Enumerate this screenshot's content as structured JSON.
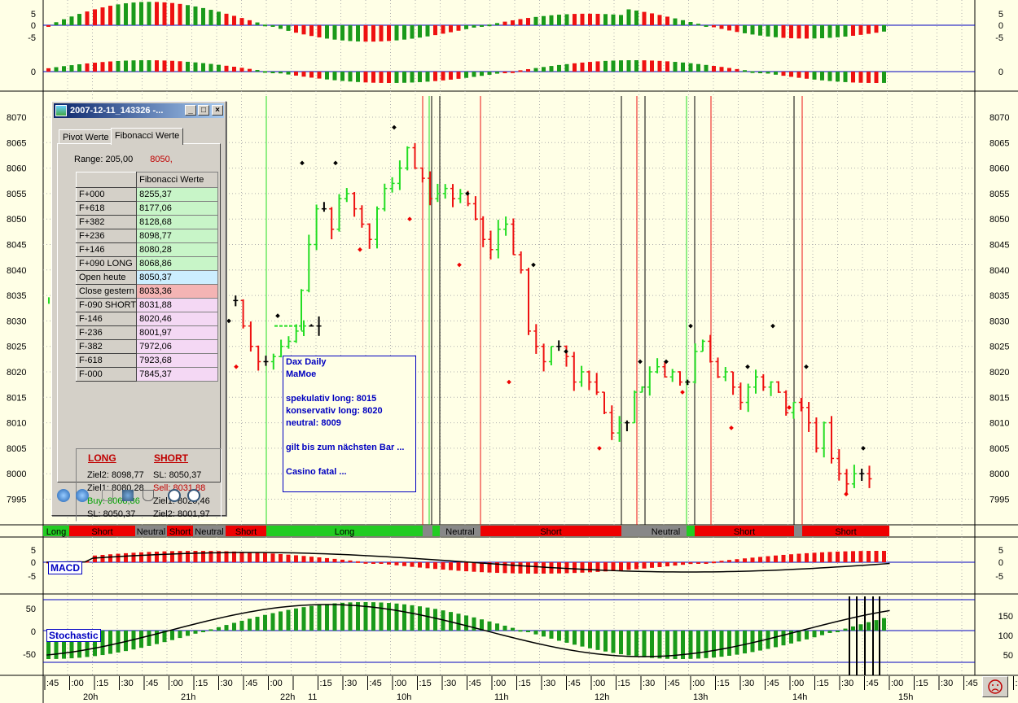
{
  "window": {
    "title": "2007-12-11_143326 -...",
    "tabs": [
      "Pivot Werte",
      "Fibonacci Werte"
    ],
    "range_label": "Range:",
    "range_value": "205,00",
    "range_ref": "8050,",
    "table_header": "Fibonacci Werte",
    "rows": [
      {
        "label": "F+000",
        "value": "8255,37",
        "color": "#c8f5c8"
      },
      {
        "label": "F+618",
        "value": "8177,06",
        "color": "#c8f5c8"
      },
      {
        "label": "F+382",
        "value": "8128,68",
        "color": "#c8f5c8"
      },
      {
        "label": "F+236",
        "value": "8098,77",
        "color": "#c8f5c8"
      },
      {
        "label": "F+146",
        "value": "8080,28",
        "color": "#c8f5c8"
      },
      {
        "label": "F+090 LONG",
        "value": "8068,86",
        "color": "#c8f5c8"
      },
      {
        "label": "Open heute",
        "value": "8050,37",
        "color": "#cceeff"
      },
      {
        "label": "Close gestern",
        "value": "8033,36",
        "color": "#f4b4b4"
      },
      {
        "label": "F-090 SHORT",
        "value": "8031,88",
        "color": "#f4d8f4"
      },
      {
        "label": "F-146",
        "value": "8020,46",
        "color": "#f4d8f4"
      },
      {
        "label": "F-236",
        "value": "8001,97",
        "color": "#f4d8f4"
      },
      {
        "label": "F-382",
        "value": "7972,06",
        "color": "#f4d8f4"
      },
      {
        "label": "F-618",
        "value": "7923,68",
        "color": "#f4d8f4"
      },
      {
        "label": "F-000",
        "value": "7845,37",
        "color": "#f4d8f4"
      }
    ],
    "long": {
      "title": "LONG",
      "ziel2": "Ziel2: 8098,77",
      "ziel1": "Ziel1: 8080,28",
      "buy": "Buy:   8068,86",
      "sl": "SL:    8050,37"
    },
    "short": {
      "title": "SHORT",
      "sl": "SL:    8050,37",
      "sell": "Sell:  8031,88",
      "ziel1": "Ziel1: 8020,46",
      "ziel2": "Ziel2: 8001,97"
    }
  },
  "note": {
    "lines": [
      "Dax Daily",
      "MaMoe",
      "",
      "spekulativ long: 8015",
      "konservativ long: 8020",
      "neutral: 8009",
      "",
      "gilt bis zum nächsten Bar ...",
      "",
      "Casino fatal ..."
    ]
  },
  "indicator_labels": {
    "macd": "MACD",
    "stochastic": "Stochastic"
  },
  "axes": {
    "price_ticks": [
      "8070",
      "8065",
      "8060",
      "8055",
      "8050",
      "8045",
      "8040",
      "8035",
      "8030",
      "8025",
      "8020",
      "8015",
      "8010",
      "8005",
      "8000",
      "7995"
    ],
    "top_ticks_left": [
      "5",
      "0",
      "-5",
      "0"
    ],
    "macd_ticks": [
      "5",
      "0",
      "-5"
    ],
    "stoch_left": [
      "50",
      "0",
      "-50"
    ],
    "stoch_right": [
      "150",
      "100",
      "50"
    ],
    "time_minor": [
      ":45",
      ":00",
      ":15",
      ":30",
      ":45",
      ":00",
      ":15",
      ":30",
      ":45",
      ":00",
      "",
      ":15",
      ":30",
      ":45",
      ":00",
      ":15",
      ":30",
      ":45",
      ":00",
      ":15",
      ":30",
      ":45",
      ":00",
      ":15",
      ":30",
      ":45",
      ":00",
      ":15",
      ":30",
      ":45",
      ":00",
      ":15",
      ":30",
      ":45",
      ":00",
      ":15",
      ":30",
      ":45",
      ":00",
      ":15",
      ":30"
    ],
    "time_hours": [
      "20h",
      "21h",
      "22h",
      "11",
      "10h",
      "11h",
      "12h",
      "13h",
      "14h",
      "15h"
    ]
  },
  "signals": [
    {
      "label": "Long",
      "color": "#22cc22"
    },
    {
      "label": "Short",
      "color": "#ee0000"
    },
    {
      "label": "Neutral",
      "color": "#888888"
    },
    {
      "label": "Short",
      "color": "#ee0000"
    },
    {
      "label": "Neutral",
      "color": "#888888"
    },
    {
      "label": "Short",
      "color": "#ee0000"
    },
    {
      "label": "Long",
      "color": "#22cc22"
    },
    {
      "label": "",
      "color": "#888888"
    },
    {
      "label": "",
      "color": "#22cc22"
    },
    {
      "label": "Neutral",
      "color": "#888888"
    },
    {
      "label": "Short",
      "color": "#ee0000"
    },
    {
      "label": "",
      "color": "#888888"
    },
    {
      "label": "Neutral",
      "color": "#888888"
    },
    {
      "label": "",
      "color": "#22cc22"
    },
    {
      "label": "Short",
      "color": "#ee0000"
    },
    {
      "label": "",
      "color": "#888888"
    },
    {
      "label": "Short",
      "color": "#ee0000"
    }
  ],
  "colors": {
    "bull": "#22dd22",
    "bear": "#ee1111",
    "neutral": "#000000",
    "hist_green": "#1a9a1a",
    "hist_red": "#ee1111",
    "line_blue": "#0000c0"
  }
}
